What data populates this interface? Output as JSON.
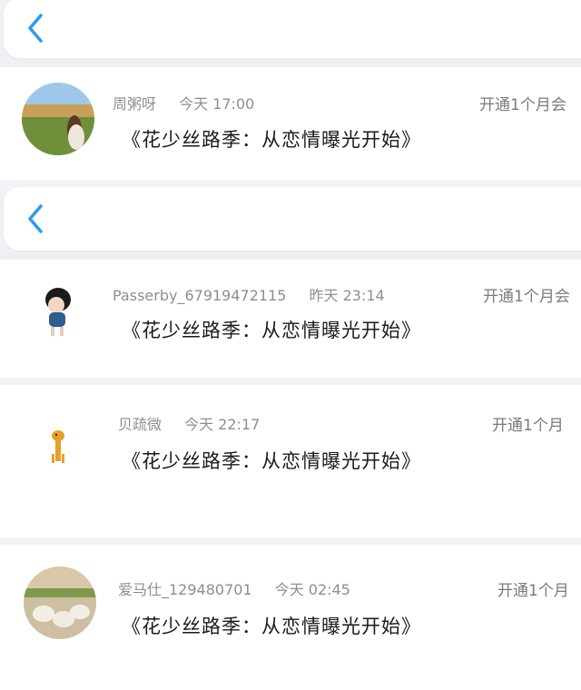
{
  "nav": {
    "back_icon": "chevron-left-icon",
    "accent": "#2b9af3"
  },
  "messages": [
    {
      "name": "周粥呀",
      "time": "今天 17:00",
      "title": "《花少丝路季：从恋情曝光开始》",
      "vip": "开通1个月会"
    },
    {
      "name": "Passerby_67919472115",
      "time": "昨天 23:14",
      "title": "《花少丝路季：从恋情曝光开始》",
      "vip": "开通1个月会"
    },
    {
      "name": "贝疏微",
      "time": "今天 22:17",
      "title": "《花少丝路季：从恋情曝光开始》",
      "vip": "开通1个月"
    },
    {
      "name": "爱马仕_129480701",
      "time": "今天 02:45",
      "title": "《花少丝路季：从恋情曝光开始》",
      "vip": "开通1个月"
    }
  ]
}
